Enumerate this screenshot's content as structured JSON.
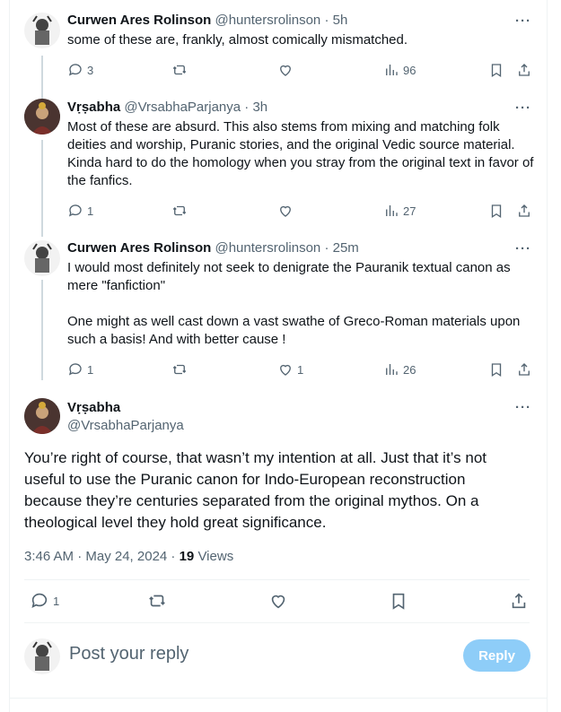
{
  "replies": [
    {
      "name": "Curwen Ares Rolinson",
      "handle": "@huntersrolinson",
      "time": "5h",
      "text": "some of these are, frankly, almost comically mismatched.",
      "replies": "3",
      "reposts": "",
      "likes": "",
      "views": "96"
    },
    {
      "name": "Vṛṣabha",
      "handle": "@VrsabhaParjanya",
      "time": "3h",
      "text": "Most of these are absurd. This also stems from mixing and matching folk deities and worship, Puranic stories, and the original Vedic source material. Kinda hard to do the homology when you stray from the original text in favor of the fanfics.",
      "replies": "1",
      "reposts": "",
      "likes": "",
      "views": "27"
    },
    {
      "name": "Curwen Ares Rolinson",
      "handle": "@huntersrolinson",
      "time": "25m",
      "text": "I would most definitely not seek to denigrate the Pauranik textual canon as mere \"fanfiction\"\n\nOne might as well cast down a vast swathe of Greco-Roman materials upon such a basis! And with better cause !",
      "replies": "1",
      "reposts": "",
      "likes": "1",
      "views": "26"
    }
  ],
  "main": {
    "name": "Vṛṣabha",
    "handle": "@VrsabhaParjanya",
    "text": "You’re right of course, that wasn’t my intention at all. Just that it’s not useful to use the Puranic canon for Indo-European reconstruction because they’re centuries separated from the original mythos. On a theological level they hold great significance.",
    "timestamp": "3:46 AM · May 24, 2024 · ",
    "views_count": "19",
    "views_label": " Views",
    "replies": "1"
  },
  "compose": {
    "placeholder": "Post your reply",
    "button": "Reply"
  },
  "separator": " · ",
  "more_glyph": "···"
}
